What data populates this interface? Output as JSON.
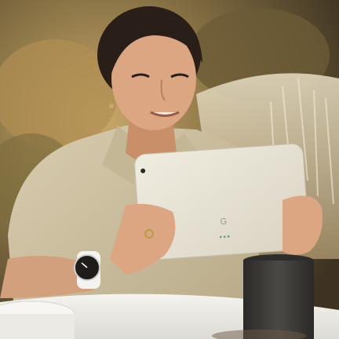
{
  "scene": {
    "subject": "woman-holding-tablet",
    "colors": {
      "background_foliage_dark": "#5a4a2a",
      "background_foliage_light": "#c9a86a",
      "grass_light": "#d8cfb8",
      "shirt": "#cfc3a6",
      "skin": "#d9a27c",
      "hair": "#2a1f18",
      "tablet": "#e7e2d3",
      "table": "#efeeea",
      "cup": "#3d3c39",
      "watch": "#1e1d1c",
      "watch_band": "#f4f3ef"
    }
  },
  "tablet": {
    "brand_logo": "G",
    "indicator_dots": 3
  }
}
